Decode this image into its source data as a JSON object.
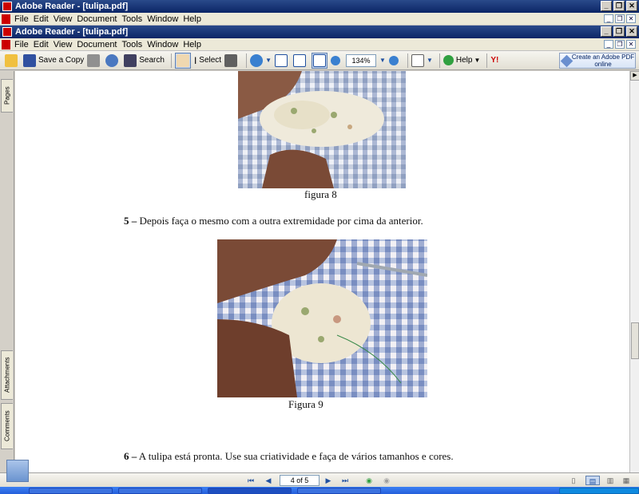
{
  "outer_window": {
    "title": "Adobe Reader - [tulipa.pdf]"
  },
  "inner_window": {
    "title": "Adobe Reader - [tulipa.pdf]"
  },
  "menu": [
    "File",
    "Edit",
    "View",
    "Document",
    "Tools",
    "Window",
    "Help"
  ],
  "toolbar": {
    "save_copy": "Save a Copy",
    "search": "Search",
    "select": "Select",
    "zoom": "134%",
    "help": "Help",
    "create_pdf": "Create an Adobe PDF online"
  },
  "side_tabs": {
    "pages": "Pages",
    "attachments": "Attachments",
    "comments": "Comments"
  },
  "document": {
    "caption8": "figura 8",
    "step5_num": "5 –",
    "step5_text": "Depois faça o mesmo com a outra extremidade por cima da anterior.",
    "caption9": "Figura 9",
    "step6_num": "6 –",
    "step6_text": "A tulipa está pronta. Use sua criatividade e faça de vários tamanhos e cores."
  },
  "status": {
    "page": "4 of 5"
  }
}
